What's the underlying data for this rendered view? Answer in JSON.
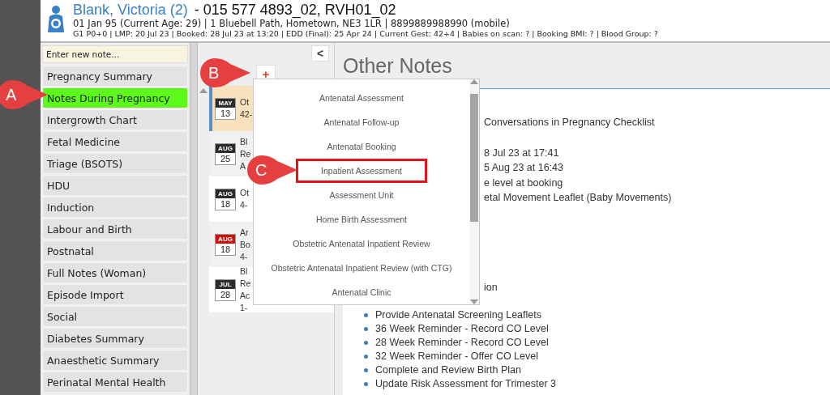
{
  "header": {
    "name": "Blank, Victoria (2)",
    "identifiers": "- 015 577 4893_02, RVH01_02",
    "details": "01 Jan 95 (Current Age: 29) | 1 Bluebell Path, Hometown, NE3 1LR | 8899889988990 (mobile)",
    "summary": "G1 P0+0 | LMP: 20 Jul 23 | Booked: 28 Jul 23 at 13:20 | EDD (Final): 25 Apr 24 | Current Gest: 42+4 | Babies on scan: ? | Booking BMI: ? | Blood Group: ?"
  },
  "sidebar": {
    "note_field": {
      "placeholder": "Enter new note..."
    },
    "items": [
      {
        "label": "Pregnancy Summary",
        "selected": false
      },
      {
        "label": "Notes During Pregnancy",
        "selected": true
      },
      {
        "label": "Intergrowth Chart",
        "selected": false
      },
      {
        "label": "Fetal Medicine",
        "selected": false
      },
      {
        "label": "Triage (BSOTS)",
        "selected": false
      },
      {
        "label": "HDU",
        "selected": false
      },
      {
        "label": "Induction",
        "selected": false
      },
      {
        "label": "Labour and Birth",
        "selected": false
      },
      {
        "label": "Postnatal",
        "selected": false
      },
      {
        "label": "Full Notes (Woman)",
        "selected": false
      },
      {
        "label": "Episode Import",
        "selected": false
      },
      {
        "label": "Social",
        "selected": false
      },
      {
        "label": "Diabetes Summary",
        "selected": false
      },
      {
        "label": "Anaesthetic Summary",
        "selected": false
      },
      {
        "label": "Perinatal Mental Health",
        "selected": false
      }
    ]
  },
  "notes": {
    "collapse_button": "<",
    "add_button": "+",
    "items": [
      {
        "month": "MAY",
        "day": "13",
        "color": "#2b2b2b",
        "lines": [
          "Ot",
          "42-"
        ],
        "selected": true
      },
      {
        "month": "AUG",
        "day": "25",
        "color": "#2b2b2b",
        "lines": [
          "Bl",
          "Re",
          "A"
        ],
        "selected": false
      },
      {
        "month": "AUG",
        "day": "18",
        "color": "#2b2b2b",
        "lines": [
          "Ot",
          "4-"
        ],
        "selected": false
      },
      {
        "month": "AUG",
        "day": "18",
        "color": "#cc1111",
        "lines": [
          "Ar",
          "Bo",
          "4-"
        ],
        "selected": false
      },
      {
        "month": "JUL",
        "day": "28",
        "color": "#2b2b2b",
        "lines": [
          "Bl",
          "Re",
          "Ac",
          "1-"
        ],
        "selected": false
      }
    ]
  },
  "content": {
    "title": "Other Notes",
    "blocks": [
      [
        "Conversations in Pregnancy Checklist"
      ],
      [
        "8 Jul 23 at 17:41",
        "5 Aug 23 at 16:43",
        "e level at booking",
        "etal Movement Leaflet (Baby Movements)"
      ],
      [
        "ion"
      ]
    ],
    "bullets": [
      "Provide Antenatal Screening Leaflets",
      "36 Week Reminder - Record CO Level",
      "28 Week Reminder - Record CO Level",
      "32 Week Reminder - Offer CO Level",
      "Complete and Review Birth Plan",
      "Update Risk Assessment for Trimester 3"
    ]
  },
  "dropdown": {
    "items": [
      {
        "label": "Antenatal Assessment",
        "highlighted": false
      },
      {
        "label": "Antenatal Follow-up",
        "highlighted": false
      },
      {
        "label": "Antenatal Booking",
        "highlighted": false
      },
      {
        "label": "Inpatient Assessment",
        "highlighted": true
      },
      {
        "label": "Assessment Unit",
        "highlighted": false
      },
      {
        "label": "Home Birth Assessment",
        "highlighted": false
      },
      {
        "label": "Obstetric Antenatal Inpatient Review",
        "highlighted": false
      },
      {
        "label": "Obstetric Antenatal Inpatient Review (with CTG)",
        "highlighted": false
      },
      {
        "label": "Antenatal Clinic",
        "highlighted": false
      }
    ]
  },
  "callouts": [
    "A",
    "B",
    "C"
  ]
}
